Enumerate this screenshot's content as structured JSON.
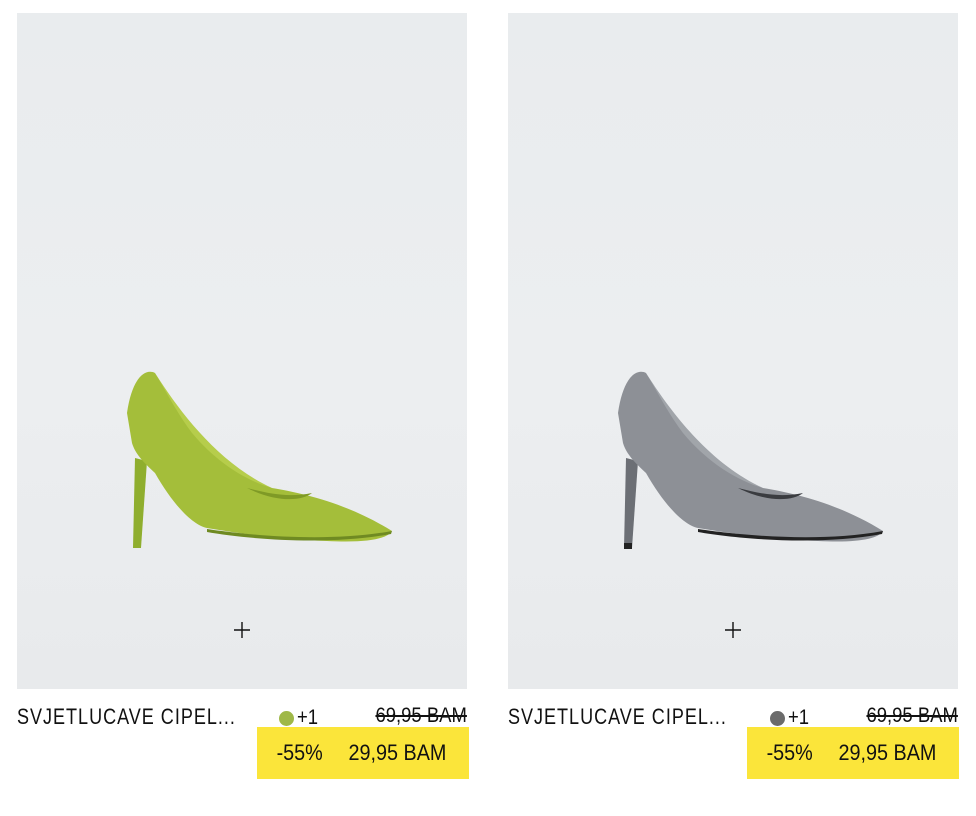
{
  "products": [
    {
      "name": "SVJETLUCAVE CIPEL...",
      "swatch_color": "#9fb848",
      "more_colors": "+1",
      "old_price": "69,95 BAM",
      "discount": "-55%",
      "sale_price": "29,95 BAM",
      "shoe_color": "#a4be3a",
      "shoe_dark": "#7f9a26",
      "sole_color": "#6f8a22"
    },
    {
      "name": "SVJETLUCAVE CIPEL...",
      "swatch_color": "#6b6b6b",
      "more_colors": "+1",
      "old_price": "69,95 BAM",
      "discount": "-55%",
      "sale_price": "29,95 BAM",
      "shoe_color": "#8d9096",
      "shoe_dark": "#5d6066",
      "sole_color": "#222222"
    }
  ],
  "icons": {
    "add": "plus-icon"
  }
}
